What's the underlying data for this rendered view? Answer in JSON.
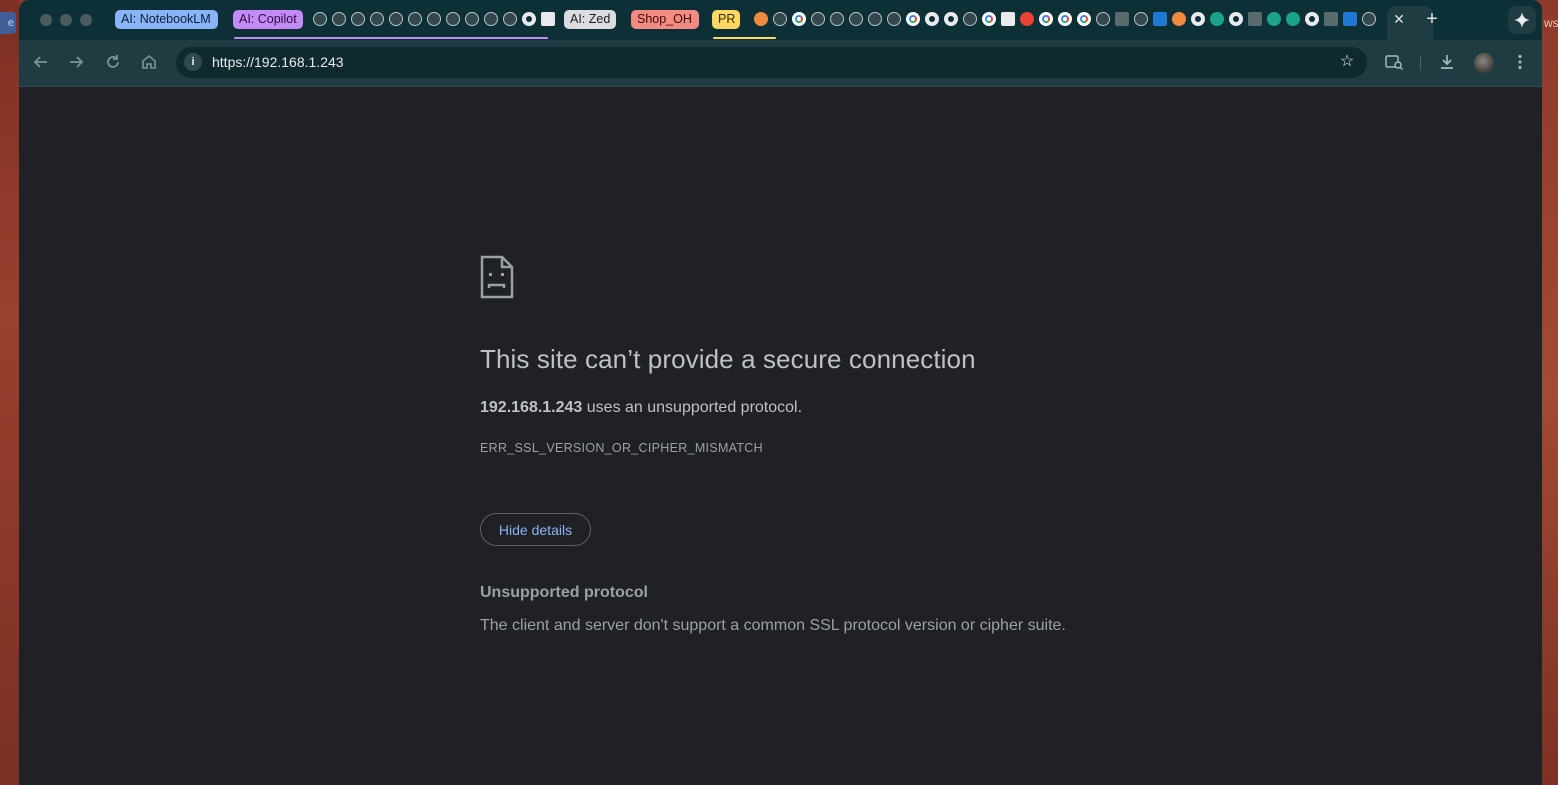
{
  "desktop": {
    "left_sliver_text": "e",
    "right_sliver_text": "ws"
  },
  "tab_groups": [
    {
      "label": "AI: NotebookLM",
      "bg": "#8ab4f8",
      "fg": "#0b1f3a"
    },
    {
      "label": "AI: Copilot",
      "bg": "#c58af9",
      "fg": "#2a0f3d"
    },
    {
      "label": "AI: Zed",
      "bg": "#dadce0",
      "fg": "#202124"
    },
    {
      "label": "Shop_OH",
      "bg": "#f28b82",
      "fg": "#3c0d0a"
    },
    {
      "label": "PR",
      "bg": "#fdd663",
      "fg": "#3a2c00"
    }
  ],
  "tabs": {
    "active_close_symbol": "✕",
    "new_tab_symbol": "+"
  },
  "toolbar": {
    "url": "https://192.168.1.243",
    "info_symbol": "i",
    "star_symbol": "☆"
  },
  "error_page": {
    "headline": "This site can’t provide a secure connection",
    "host": "192.168.1.243",
    "summary_rest": " uses an unsupported protocol.",
    "error_code": "ERR_SSL_VERSION_OR_CIPHER_MISMATCH",
    "details_button": "Hide details",
    "details_title": "Unsupported protocol",
    "details_text": "The client and server don't support a common SSL protocol version or cipher suite."
  },
  "icons": [
    "back-icon",
    "forward-icon",
    "reload-icon",
    "home-icon",
    "info-icon",
    "star-icon",
    "screen-search-icon",
    "download-icon",
    "avatar",
    "menu-icon",
    "gemini-icon",
    "sad-page-icon"
  ],
  "colors": {
    "page_bg": "#202124",
    "tabstrip_bg": "#0d3036",
    "toolbar_bg": "#1f3c42",
    "link_blue": "#8ab4f8"
  }
}
